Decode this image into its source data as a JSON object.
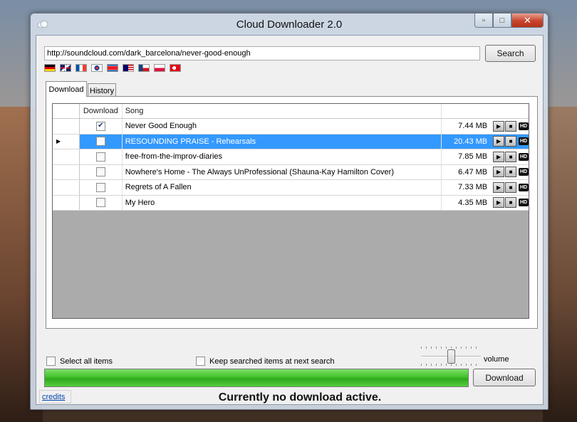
{
  "window": {
    "title": "Cloud Downloader 2.0"
  },
  "search": {
    "url": "http://soundcloud.com/dark_barcelona/never-good-enough",
    "button_label": "Search"
  },
  "flags": [
    {
      "name": "german-flag-icon"
    },
    {
      "name": "uk-flag-icon"
    },
    {
      "name": "french-flag-icon"
    },
    {
      "name": "south-korea-flag-icon"
    },
    {
      "name": "north-korea-flag-icon"
    },
    {
      "name": "malaysia-flag-icon"
    },
    {
      "name": "czech-flag-icon"
    },
    {
      "name": "poland-flag-icon"
    },
    {
      "name": "turkey-flag-icon"
    }
  ],
  "tabs": [
    {
      "label": "Download",
      "active": true
    },
    {
      "label": "History",
      "active": false
    }
  ],
  "grid": {
    "headers": {
      "download": "Download",
      "song": "Song"
    },
    "rows": [
      {
        "checked": true,
        "song": "Never Good Enough",
        "size": "7.44 MB",
        "selected": false
      },
      {
        "checked": false,
        "song": "RESOUNDING PRAISE - Rehearsals",
        "size": "20.43 MB",
        "selected": true
      },
      {
        "checked": false,
        "song": "free-from-the-improv-diaries",
        "size": "7.85 MB",
        "selected": false
      },
      {
        "checked": false,
        "song": "Nowhere's Home - The Always UnProfessional (Shauna-Kay Hamilton Cover)",
        "size": "6.47 MB",
        "selected": false
      },
      {
        "checked": false,
        "song": "Regrets of A Fallen",
        "size": "7.33 MB",
        "selected": false
      },
      {
        "checked": false,
        "song": "My Hero",
        "size": "4.35 MB",
        "selected": false
      }
    ],
    "hd_label": "HD"
  },
  "options": {
    "select_all": "Select all items",
    "keep_searched": "Keep searched items at next search"
  },
  "volume": {
    "label": "volume",
    "level": 0.5
  },
  "progress": {
    "fraction": 1.0
  },
  "download_button": "Download",
  "credits": "credits",
  "status": "Currently no download active."
}
